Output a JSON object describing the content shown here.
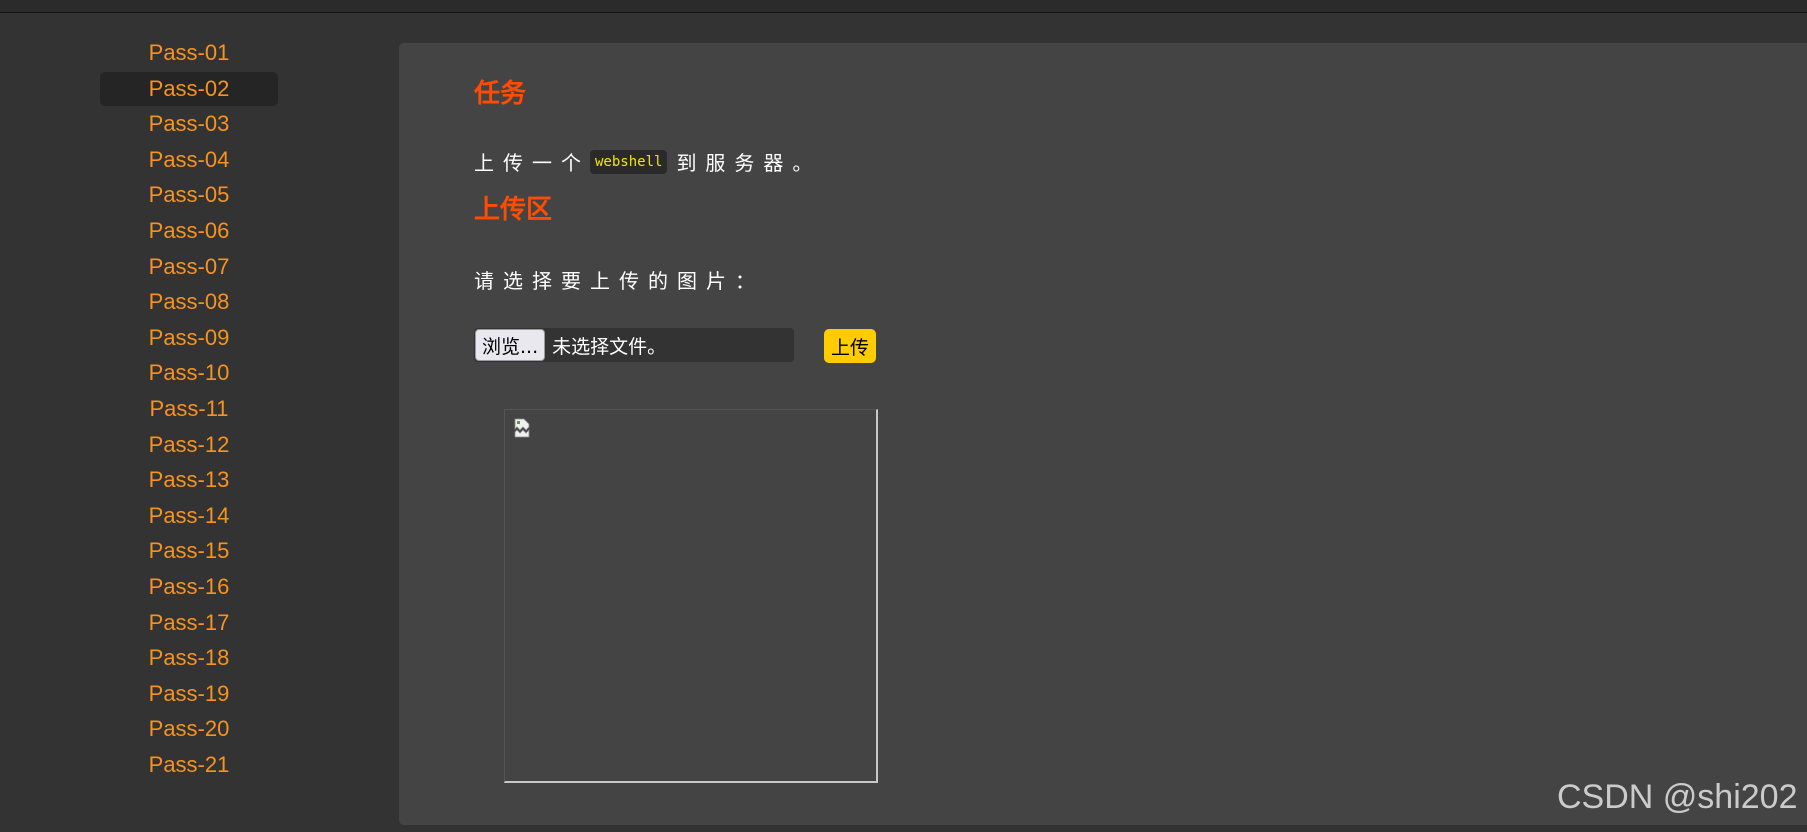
{
  "sidebar": {
    "items": [
      {
        "label": "Pass-01"
      },
      {
        "label": "Pass-02",
        "active": true
      },
      {
        "label": "Pass-03"
      },
      {
        "label": "Pass-04"
      },
      {
        "label": "Pass-05"
      },
      {
        "label": "Pass-06"
      },
      {
        "label": "Pass-07"
      },
      {
        "label": "Pass-08"
      },
      {
        "label": "Pass-09"
      },
      {
        "label": "Pass-10"
      },
      {
        "label": "Pass-11"
      },
      {
        "label": "Pass-12"
      },
      {
        "label": "Pass-13"
      },
      {
        "label": "Pass-14"
      },
      {
        "label": "Pass-15"
      },
      {
        "label": "Pass-16"
      },
      {
        "label": "Pass-17"
      },
      {
        "label": "Pass-18"
      },
      {
        "label": "Pass-19"
      },
      {
        "label": "Pass-20"
      },
      {
        "label": "Pass-21"
      }
    ]
  },
  "task": {
    "heading": "任务",
    "text_before": "上传一个",
    "code": "webshell",
    "text_after": "到服务器。"
  },
  "upload": {
    "heading": "上传区",
    "prompt": "请选择要上传的图片：",
    "browse_label": "浏览...",
    "file_status": "未选择文件。",
    "submit_label": "上传"
  },
  "preview": {
    "icon": "broken-image-icon"
  },
  "watermark": "CSDN @shi202",
  "colors": {
    "background": "#333333",
    "panel": "#444444",
    "nav_link": "#f7931e",
    "heading": "#ff4c00",
    "code_text": "#f5e400",
    "upload_button": "#ffcc00"
  }
}
